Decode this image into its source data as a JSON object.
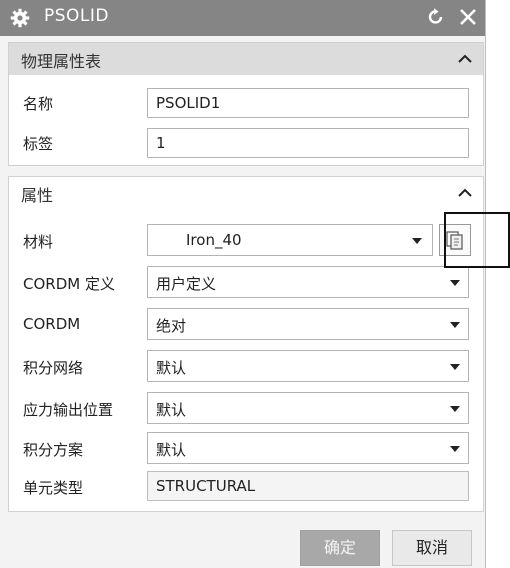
{
  "window": {
    "title": "PSOLID",
    "icon": "gear-icon",
    "actions": [
      "reset-icon",
      "close-icon"
    ]
  },
  "physical_properties": {
    "header": "物理属性表",
    "name_label": "名称",
    "name_value": "PSOLID1",
    "tag_label": "标签",
    "tag_value": "1"
  },
  "attributes": {
    "header": "属性",
    "material_label": "材料",
    "material_value": "Iron_40",
    "cordm_def_label": "CORDM 定义",
    "cordm_def_value": "用户定义",
    "cordm_label": "CORDM",
    "cordm_value": "绝对",
    "integration_grid_label": "积分网络",
    "integration_grid_value": "默认",
    "stress_output_label": "应力输出位置",
    "stress_output_value": "默认",
    "integration_scheme_label": "积分方案",
    "integration_scheme_value": "默认",
    "element_type_label": "单元类型",
    "element_type_value": "STRUCTURAL"
  },
  "buttons": {
    "ok_label": "确定",
    "cancel_label": "取消"
  },
  "colors": {
    "titlebar": "#858585",
    "dialog_bg": "#f3f3f3",
    "ok_disabled": "#a8a8a8"
  }
}
